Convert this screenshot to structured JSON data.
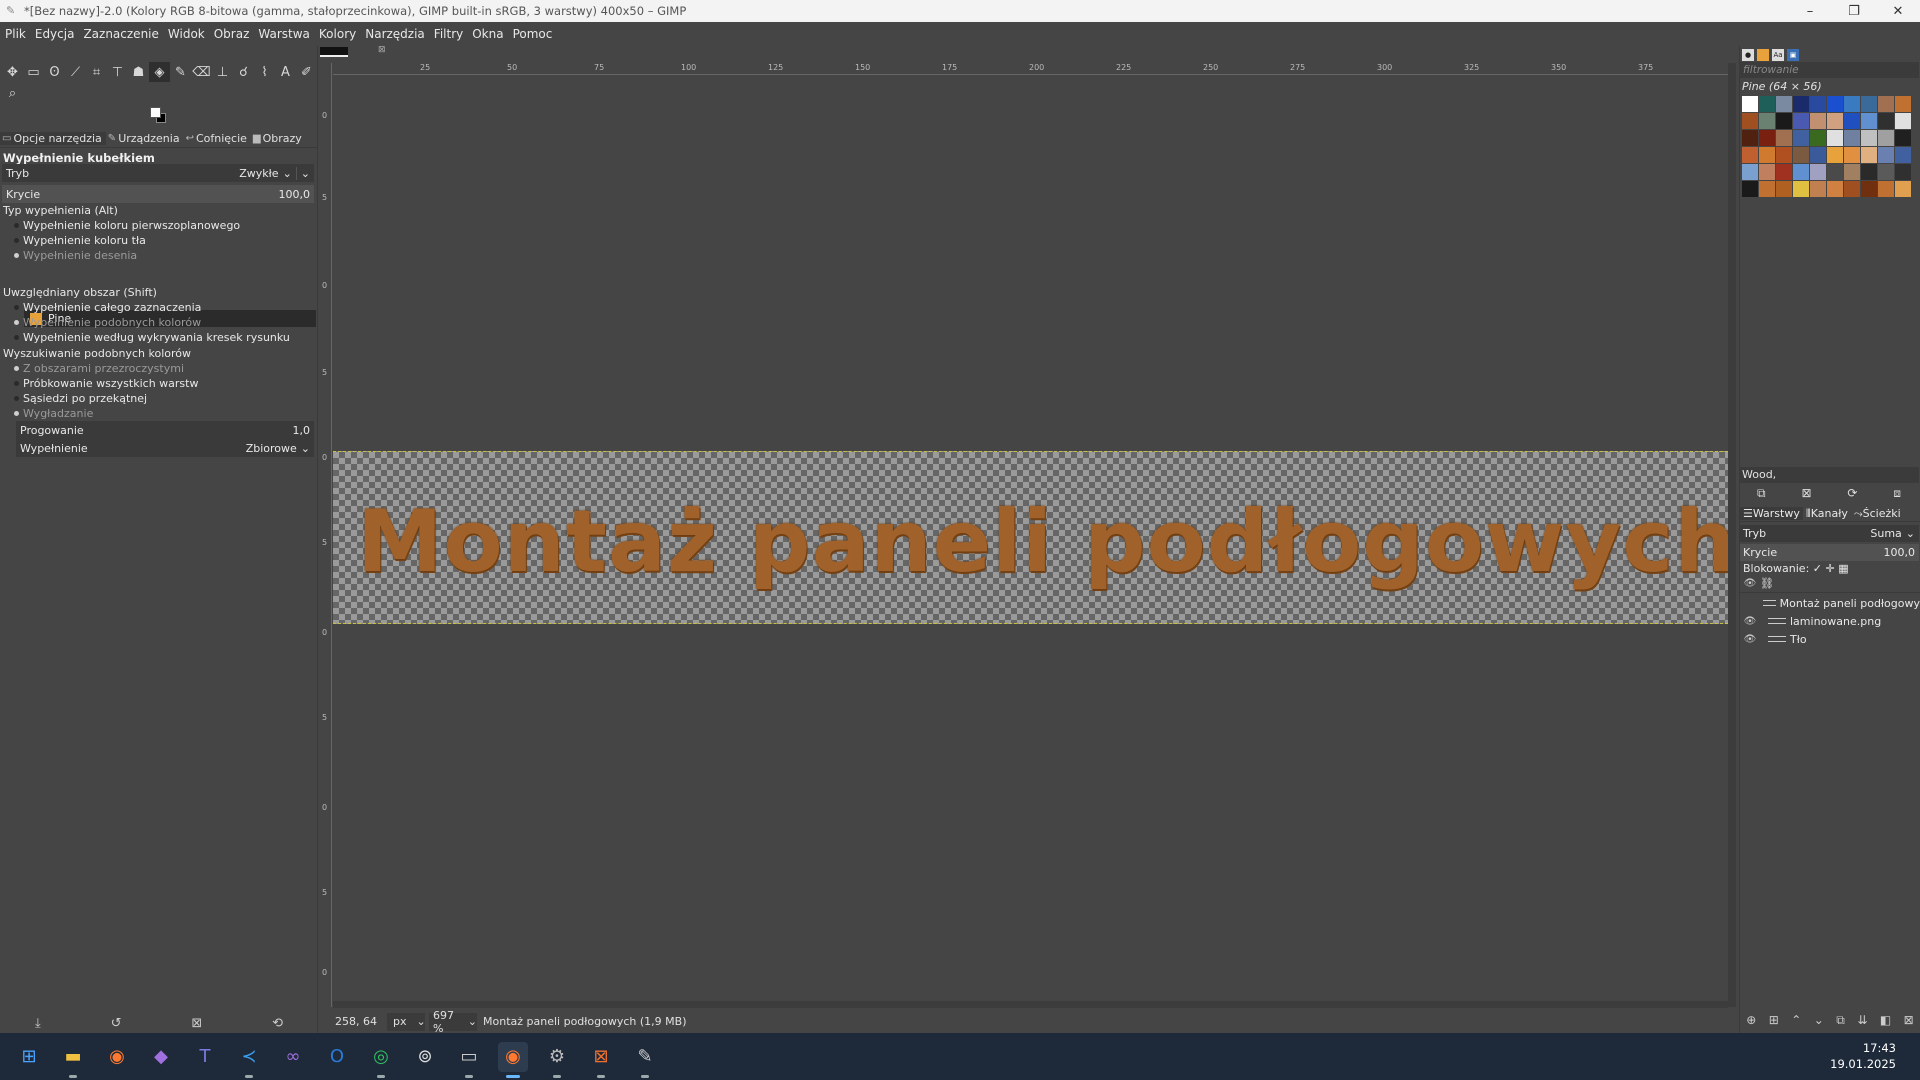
{
  "window": {
    "title": "*[Bez nazwy]-2.0 (Kolory RGB 8-bitowa (gamma, stałoprzecinkowa), GIMP built-in sRGB, 3 warstwy) 400x50 – GIMP",
    "minimize_icon": "minimize-icon",
    "maximize_icon": "maximize-icon",
    "close_icon": "close-icon"
  },
  "menu": [
    "Plik",
    "Edycja",
    "Zaznaczenie",
    "Widok",
    "Obraz",
    "Warstwa",
    "Kolory",
    "Narzędzia",
    "Filtry",
    "Okna",
    "Pomoc"
  ],
  "left_tabs": [
    {
      "label": "Opcje narzędzia",
      "icon": "tool-options-icon"
    },
    {
      "label": "Urządzenia",
      "icon": "devices-icon"
    },
    {
      "label": "Cofnięcie",
      "icon": "undo-icon"
    },
    {
      "label": "Obrazy",
      "icon": "images-icon"
    }
  ],
  "tool_options": {
    "title": "Wypełnienie kubełkiem",
    "mode_label": "Tryb",
    "mode_value": "Zwykłe",
    "opacity_label": "Krycie",
    "opacity_value": "100,0",
    "fill_type_label": "Typ wypełnienia  (Alt)",
    "fill_type_options": [
      "Wypełnienie koloru pierwszoplanowego",
      "Wypełnienie koloru tła",
      "Wypełnienie desenia"
    ],
    "pattern_name": "Pine",
    "area_label": "Uwzględniany obszar  (Shift)",
    "area_options": [
      "Wypełnienie całego zaznaczenia",
      "Wypełnienie podobnych kolorów",
      "Wypełnienie według wykrywania kresek rysunku"
    ],
    "similar_label": "Wyszukiwanie podobnych kolorów",
    "similar_options": [
      "Z obszarami przezroczystymi",
      "Próbkowanie wszystkich warstw",
      "Sąsiedzi po przekątnej",
      "Wygładzanie"
    ],
    "threshold_label": "Progowanie",
    "threshold_value": "1,0",
    "fill_by_label": "Wypełnienie",
    "fill_by_value": "Zbiorowe"
  },
  "canvas": {
    "text": "Montaż paneli podłogowych",
    "ruler_h": [
      "25",
      "50",
      "75",
      "100",
      "125",
      "150",
      "175",
      "200",
      "225",
      "250",
      "275",
      "300",
      "325",
      "350",
      "375"
    ],
    "ruler_v": [
      "0",
      "5",
      "0",
      "5",
      "0",
      "5",
      "0",
      "5",
      "0",
      "5",
      "0",
      "5"
    ]
  },
  "status": {
    "coords": "258, 64",
    "unit": "px",
    "zoom": "697 %",
    "message": "Montaż paneli podłogowych (1,9 MB)"
  },
  "patterns": {
    "filter_placeholder": "filtrowanie",
    "current": "Pine (64 × 56)",
    "tag_value": "Wood,",
    "swatches": [
      "#ffffff",
      "#1f5f5a",
      "#7a8aa0",
      "#1a2a6a",
      "#2a4aa0",
      "#1a50d0",
      "#3a7ac0",
      "#3a6a9a",
      "#a07050",
      "#c07030",
      "#a05020",
      "#6a8070",
      "#1a1a1a",
      "#4a5ab0",
      "#c09070",
      "#d0a080",
      "#2050c0",
      "#6090d0",
      "#303030",
      "#e0e0e0",
      "#502010",
      "#7a2010",
      "#a07050",
      "#4060a0",
      "#3a6a20",
      "#e0e0e0",
      "#7080a0",
      "#c0c0c0",
      "#a0a0a0",
      "#202020",
      "#c06030",
      "#d07a30",
      "#b05020",
      "#7a5a40",
      "#3a5a9a",
      "#e8a23c",
      "#e09040",
      "#e0b080",
      "#6a80b0",
      "#4060a0",
      "#7aa0d0",
      "#c08060",
      "#a03020",
      "#6090d0",
      "#a0a0c0",
      "#4a4a4a",
      "#a08060",
      "#2a2a2a",
      "#5a5a5a",
      "#303030",
      "#1a1a1a",
      "#c07030",
      "#b06020",
      "#e0c040",
      "#c08050",
      "#d08040",
      "#a05020",
      "#703010",
      "#c07030",
      "#e0a050"
    ]
  },
  "layers_tabs": [
    {
      "label": "Warstwy",
      "icon": "layers-icon"
    },
    {
      "label": "Kanały",
      "icon": "channels-icon"
    },
    {
      "label": "Ścieżki",
      "icon": "paths-icon"
    }
  ],
  "layers_panel": {
    "mode_label": "Tryb",
    "mode_value": "Suma",
    "opacity_label": "Krycie",
    "opacity_value": "100,0",
    "lock_label": "Blokowanie: ✓ ✛ ▦",
    "layers": [
      {
        "name": "Montaż paneli podłogowy",
        "visible": false
      },
      {
        "name": "laminowane.png",
        "visible": true
      },
      {
        "name": "Tło",
        "visible": true
      }
    ]
  },
  "taskbar": {
    "apps": [
      "windows-start-icon",
      "file-explorer-icon",
      "firefox-icon",
      "tor-browser-icon",
      "teams-icon",
      "vscode-icon",
      "visual-studio-icon",
      "outlook-icon",
      "spotify-icon",
      "keepass-icon",
      "terminal-icon",
      "firefox-active-icon",
      "settings-icon",
      "xampp-icon",
      "gimp-icon"
    ],
    "time": "17:43",
    "date": "19.01.2025"
  }
}
